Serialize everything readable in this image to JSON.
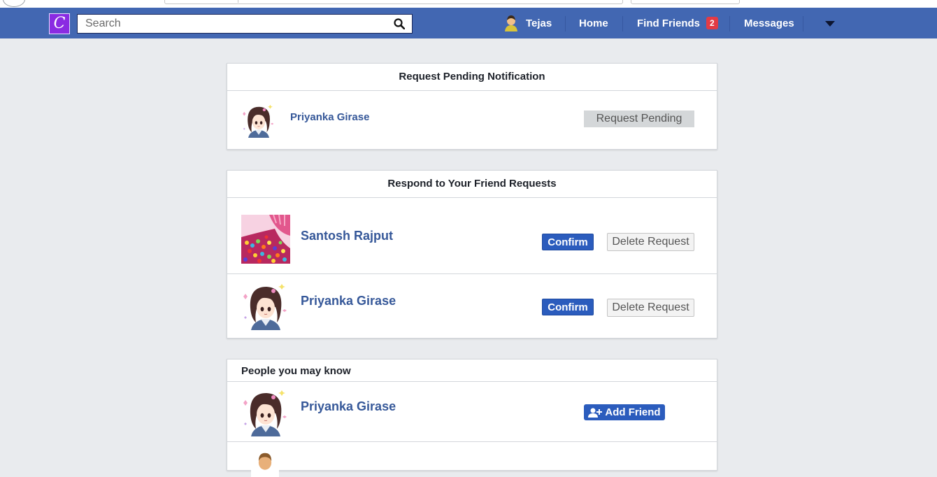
{
  "header": {
    "logo_letter": "C",
    "search_placeholder": "Search",
    "user_name": "Tejas",
    "home": "Home",
    "find_friends": "Find Friends",
    "find_friends_count": "2",
    "messages": "Messages"
  },
  "pending": {
    "title": "Request Pending Notification",
    "items": [
      {
        "name": "Priyanka Girase",
        "status": "Request Pending"
      }
    ]
  },
  "requests": {
    "title": "Respond to Your Friend Requests",
    "confirm_label": "Confirm",
    "delete_label": "Delete Request",
    "items": [
      {
        "name": "Santosh Rajput",
        "avatar": "colorful-candy-photo"
      },
      {
        "name": "Priyanka Girase",
        "avatar": "anime-girl-avatar"
      }
    ]
  },
  "suggestions": {
    "title": "People you may know",
    "add_label": "Add Friend",
    "items": [
      {
        "name": "Priyanka Girase",
        "avatar": "anime-girl-avatar"
      },
      {
        "name": "",
        "avatar": "man-avatar"
      }
    ]
  },
  "colors": {
    "topbar": "#4267b2",
    "background": "#e9ebee",
    "button_blue": "#2b5cbd",
    "link_name": "#365899",
    "badge": "#e23b45"
  }
}
